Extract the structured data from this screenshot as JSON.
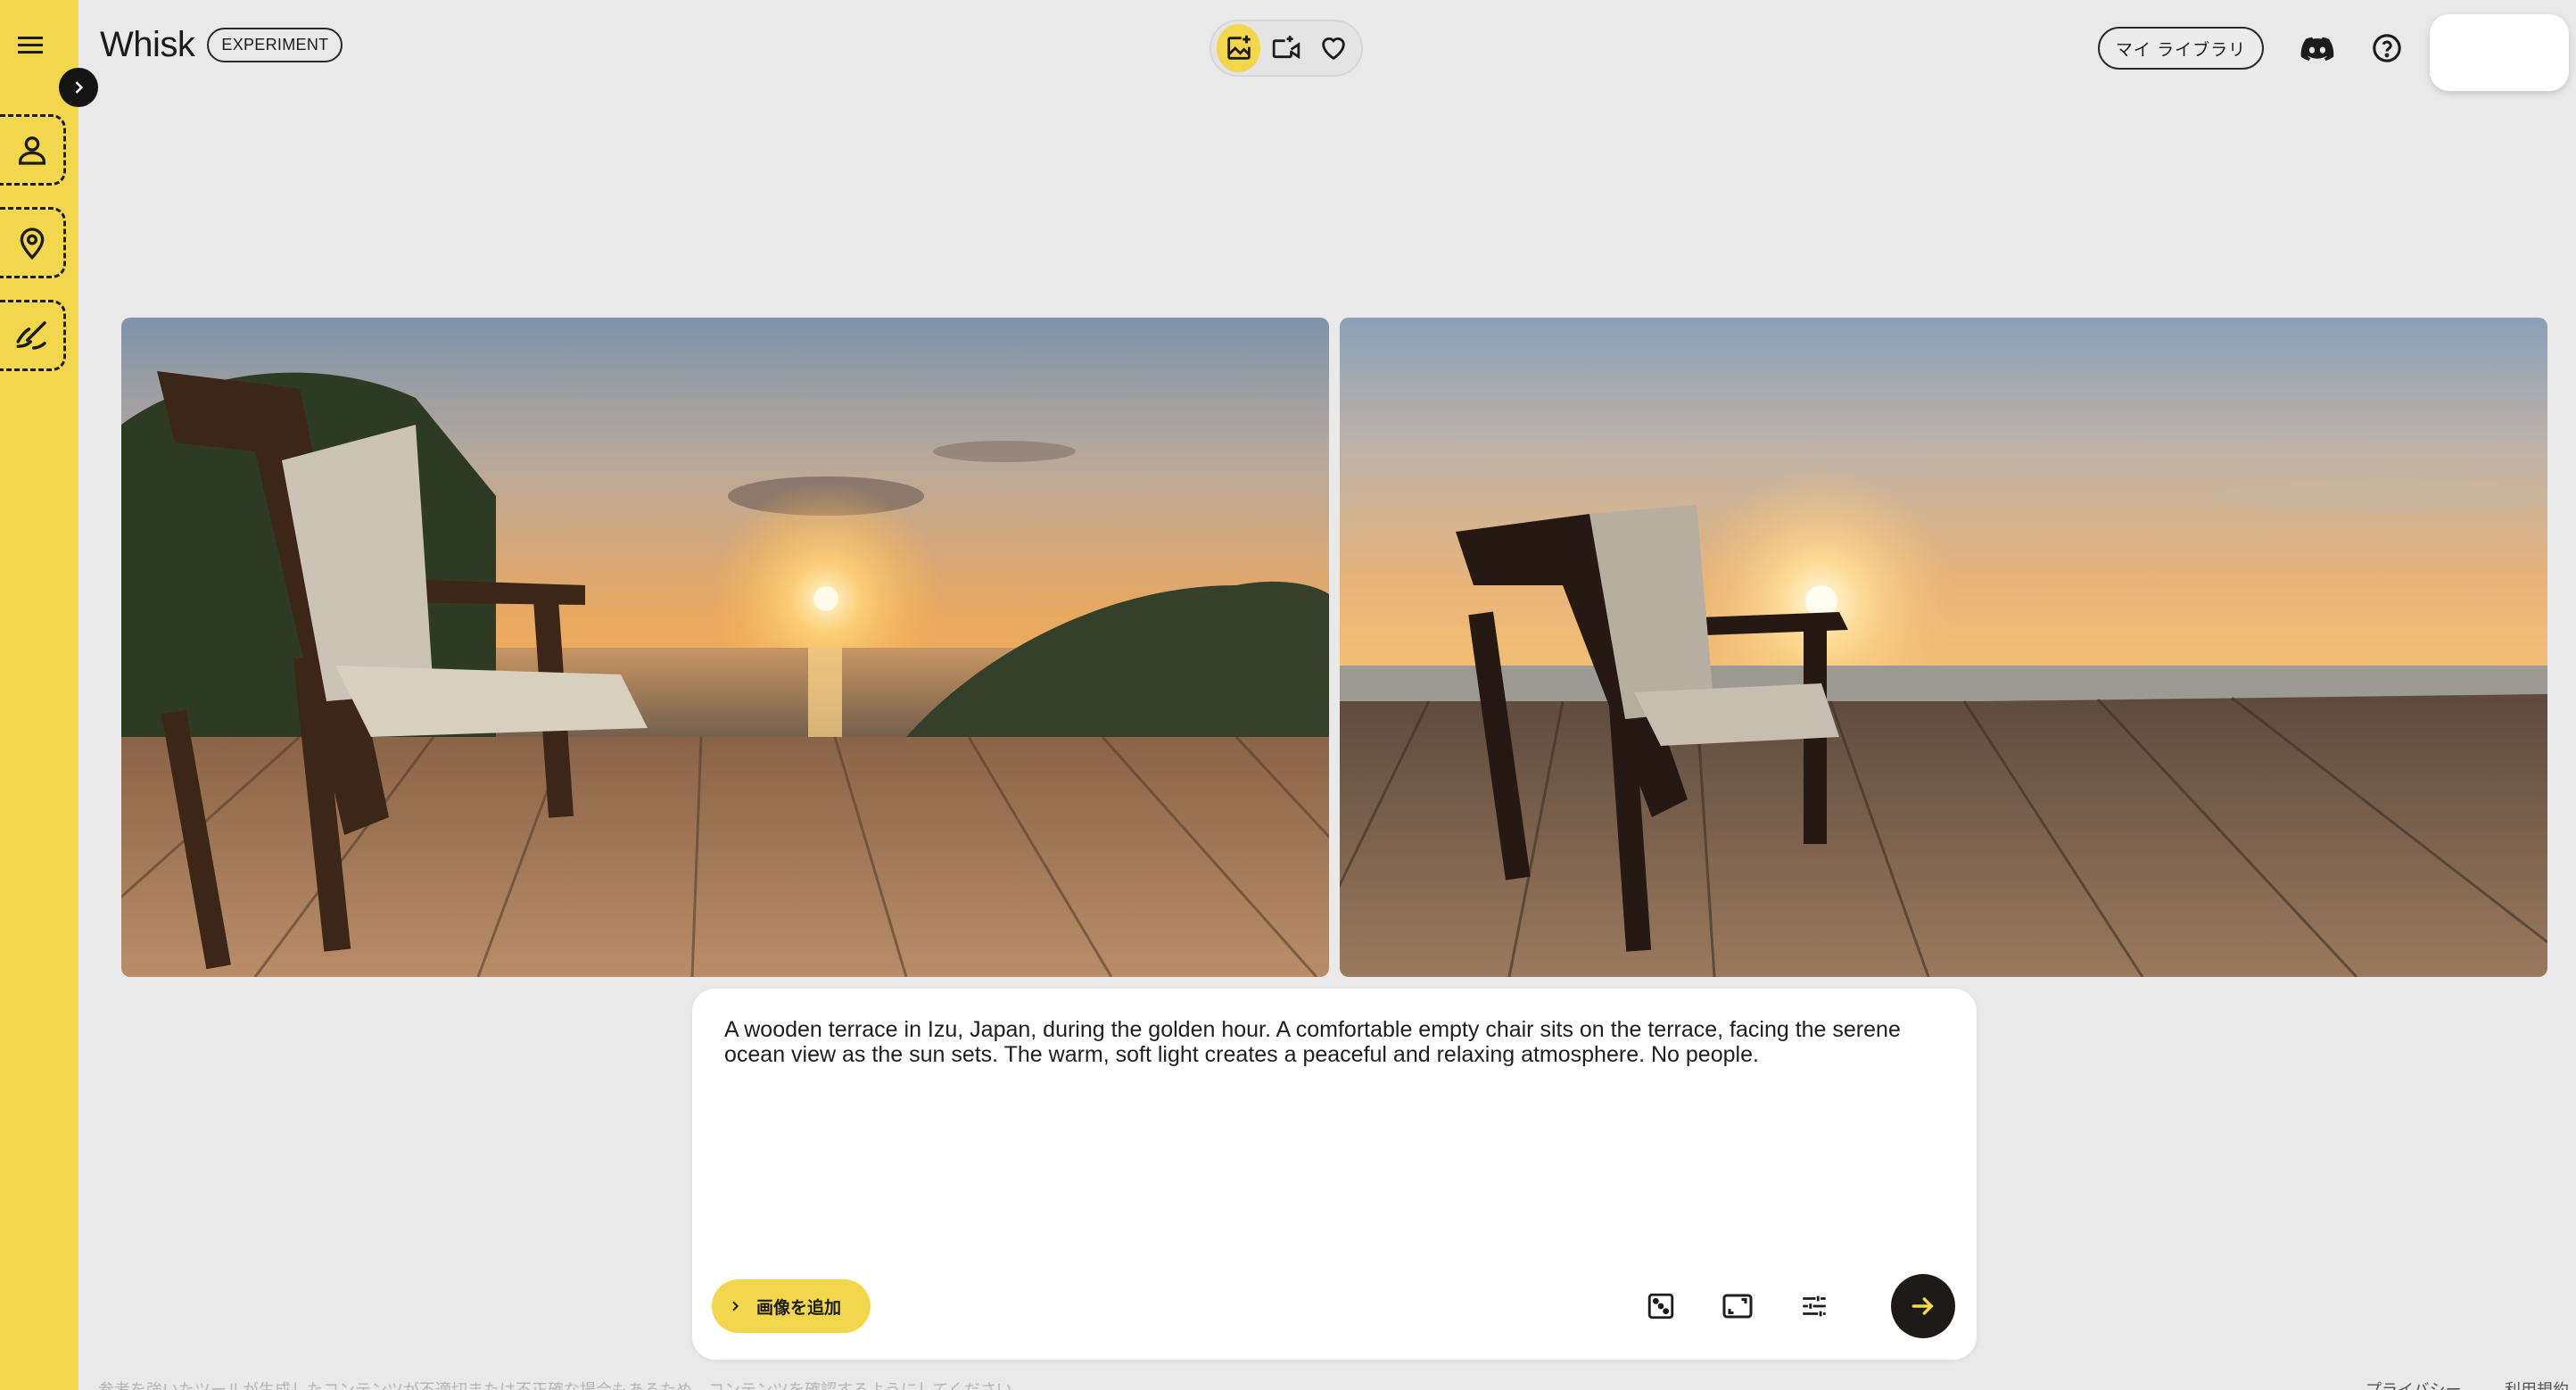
{
  "app": {
    "title": "Whisk",
    "badge": "EXPERIMENT"
  },
  "sidebar": {
    "menu_icon": "hamburger-menu-icon",
    "expand_icon": "chevron-right-icon",
    "slots": [
      {
        "name": "subject",
        "icon": "person-icon"
      },
      {
        "name": "scene",
        "icon": "location-pin-icon"
      },
      {
        "name": "style",
        "icon": "brush-icon"
      }
    ]
  },
  "modebar": {
    "modes": [
      {
        "name": "image",
        "icon": "image-spark-icon",
        "active": true
      },
      {
        "name": "video",
        "icon": "video-spark-icon",
        "active": false
      },
      {
        "name": "favorites",
        "icon": "heart-icon",
        "active": false
      }
    ]
  },
  "header": {
    "library_label": "マイ ライブラリ",
    "discord_icon": "discord-icon",
    "help_icon": "help-circle-icon"
  },
  "gallery": {
    "images": [
      {
        "name": "generated-image-1",
        "subject": "wooden chair on terrace, sunset over ocean with trees"
      },
      {
        "name": "generated-image-2",
        "subject": "wooden chair on deck facing sunset over sea"
      }
    ]
  },
  "prompt": {
    "text": "A wooden terrace in Izu, Japan, during the golden hour. A comfortable empty chair sits on the terrace, facing the serene ocean view as the sun sets. The warm, soft light creates a peaceful and relaxing atmosphere. No people.",
    "add_image_label": "画像を追加",
    "tools": [
      {
        "name": "random-dice-button",
        "icon": "dice-icon"
      },
      {
        "name": "aspect-ratio-button",
        "icon": "aspect-ratio-icon"
      },
      {
        "name": "settings-sliders-button",
        "icon": "tune-sliders-icon"
      }
    ],
    "submit_icon": "arrow-right-icon"
  },
  "footer": {
    "note": "参考を強いたツールが生成したコンテンツが不適切または不正確な場合もあるため、コンテンツを確認するようにしてください。",
    "privacy": "プライバシー",
    "terms": "利用規約"
  },
  "colors": {
    "accent_yellow": "#f2d64b",
    "background": "#e9e9e9",
    "dark": "#1e1a1a"
  }
}
